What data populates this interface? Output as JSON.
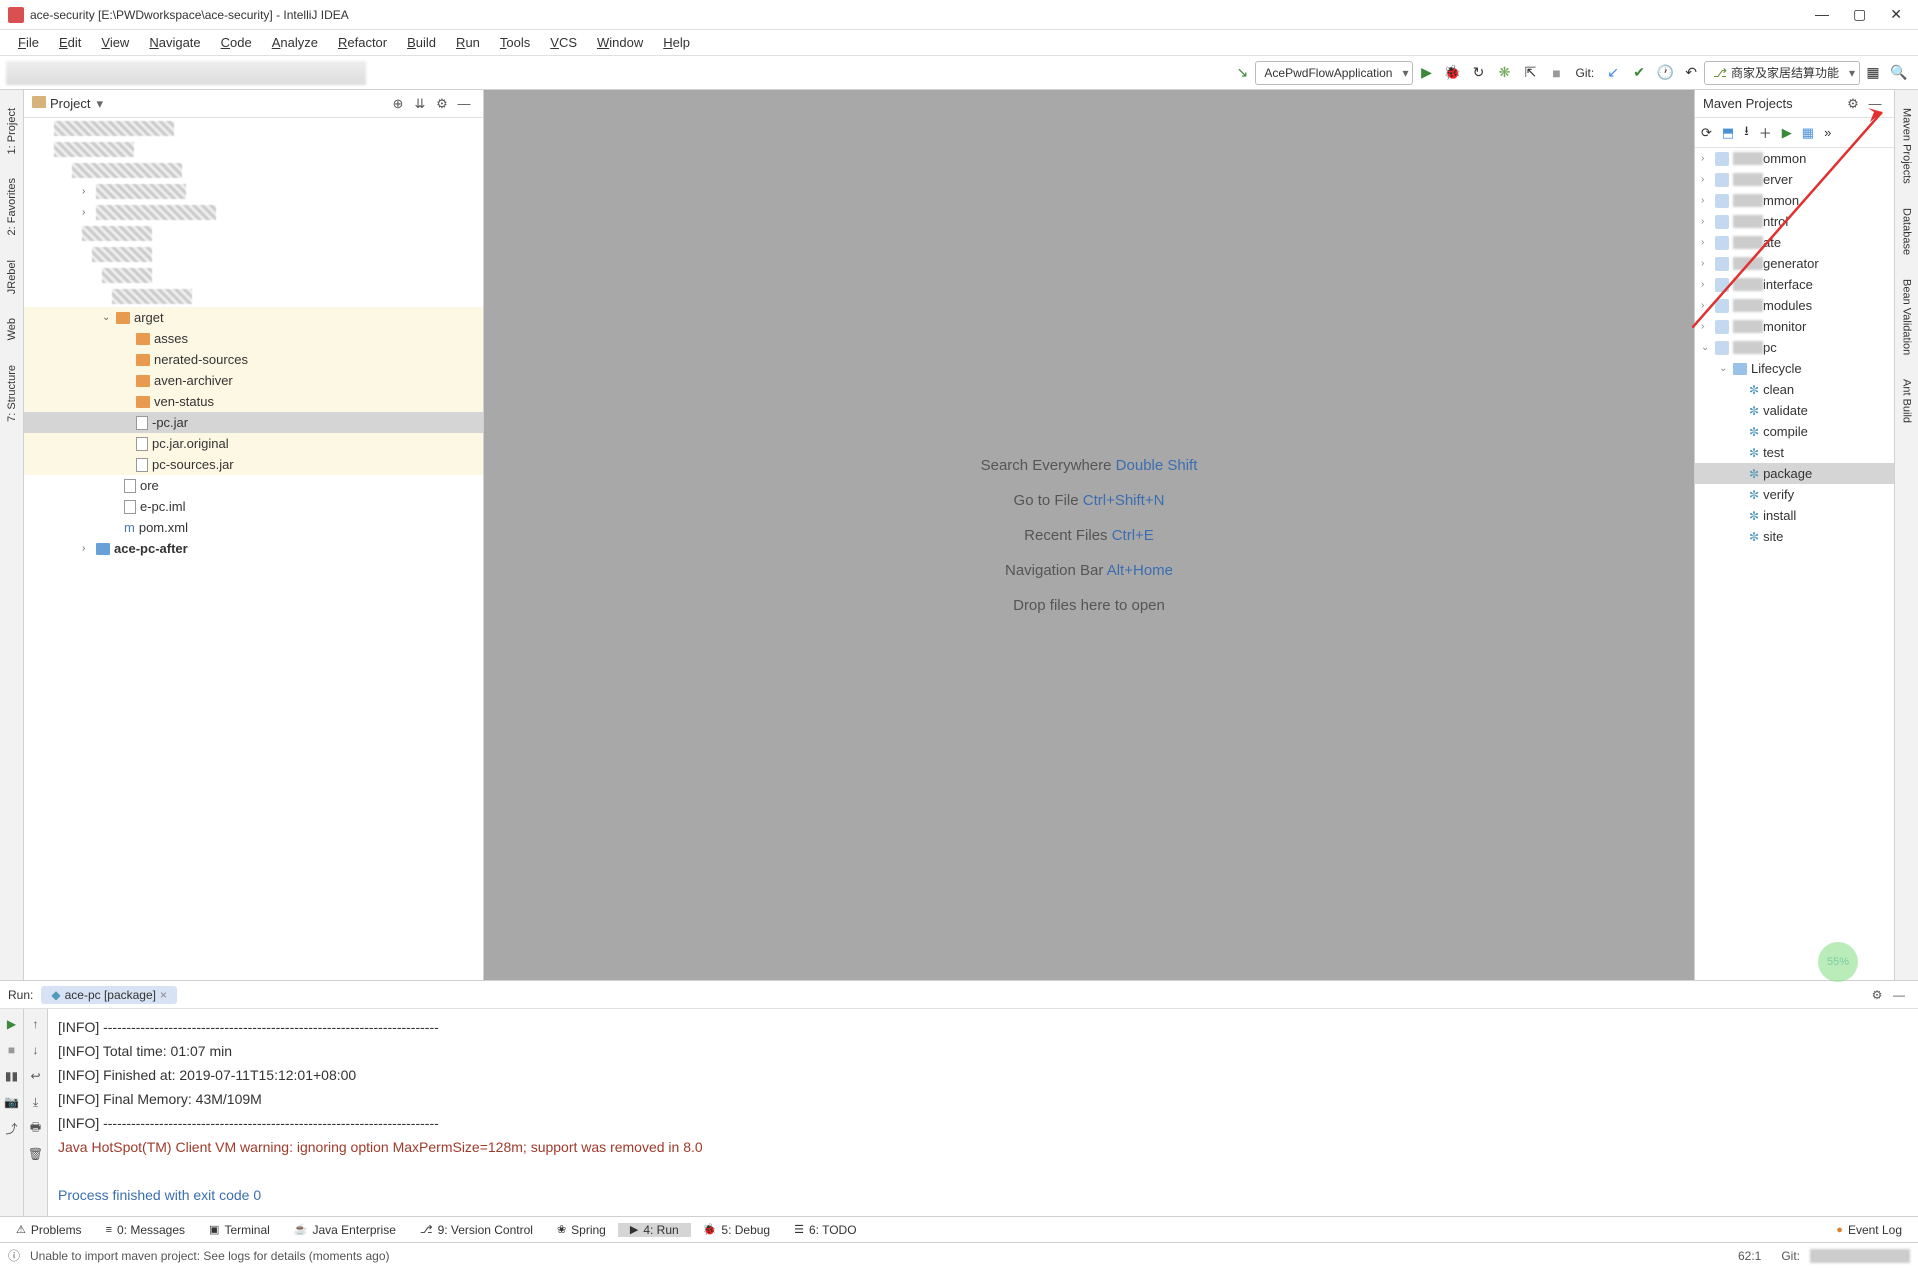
{
  "window": {
    "title": "ace-security [E:\\PWDworkspace\\ace-security] - IntelliJ IDEA"
  },
  "menu": [
    "File",
    "Edit",
    "View",
    "Navigate",
    "Code",
    "Analyze",
    "Refactor",
    "Build",
    "Run",
    "Tools",
    "VCS",
    "Window",
    "Help"
  ],
  "toolbar": {
    "run_config": "AcePwdFlowApplication",
    "git_label": "Git:",
    "branch_label": "商家及家居结算功能"
  },
  "panels": {
    "project": {
      "title": "Project"
    },
    "maven": {
      "title": "Maven Projects"
    }
  },
  "left_tabs": [
    "1: Project",
    "2: Favorites",
    "JRebel",
    "Web",
    "7: Structure"
  ],
  "right_tabs": [
    "Maven Projects",
    "Database",
    "Bean Validation",
    "Ant Build"
  ],
  "project_tree": {
    "target": "arget",
    "classes": "asses",
    "gensources": "nerated-sources",
    "archiver": "aven-archiver",
    "status": "ven-status",
    "pcjar": "-pc.jar",
    "pcjarorig": "pc.jar.original",
    "pcsources": "pc-sources.jar",
    "more": "ore",
    "iml": "e-pc.iml",
    "pom": "pom.xml",
    "after": "ace-pc-after"
  },
  "editor_hints": {
    "search": "Search Everywhere",
    "search_key": "Double Shift",
    "gotofile": "Go to File",
    "gotofile_key": "Ctrl+Shift+N",
    "recent": "Recent Files",
    "recent_key": "Ctrl+E",
    "navbar": "Navigation Bar",
    "navbar_key": "Alt+Home",
    "drop": "Drop files here to open"
  },
  "maven_tree": {
    "suffixes": [
      "ommon",
      "erver",
      "mmon",
      "ntrol",
      "ate",
      "generator",
      "interface",
      "modules",
      "monitor",
      "pc"
    ],
    "lifecycle_label": "Lifecycle",
    "lifecycle": [
      "clean",
      "validate",
      "compile",
      "test",
      "package",
      "verify",
      "install",
      "site"
    ]
  },
  "run": {
    "label": "Run:",
    "tab": "ace-pc [package]",
    "console": [
      {
        "cls": "",
        "text": "[INFO] ------------------------------------------------------------------------"
      },
      {
        "cls": "",
        "text": "[INFO] Total time: 01:07 min"
      },
      {
        "cls": "",
        "text": "[INFO] Finished at: 2019-07-11T15:12:01+08:00"
      },
      {
        "cls": "",
        "text": "[INFO] Final Memory: 43M/109M"
      },
      {
        "cls": "",
        "text": "[INFO] ------------------------------------------------------------------------"
      },
      {
        "cls": "warn",
        "text": "Java HotSpot(TM) Client VM warning: ignoring option MaxPermSize=128m; support was removed in 8.0"
      },
      {
        "cls": "",
        "text": ""
      },
      {
        "cls": "exit",
        "text": "Process finished with exit code 0"
      }
    ]
  },
  "bottom_tabs": [
    {
      "icon": "⚠",
      "label": "Problems"
    },
    {
      "icon": "≡",
      "label": "0: Messages"
    },
    {
      "icon": "▣",
      "label": "Terminal"
    },
    {
      "icon": "☕",
      "label": "Java Enterprise"
    },
    {
      "icon": "⎇",
      "label": "9: Version Control"
    },
    {
      "icon": "❀",
      "label": "Spring"
    },
    {
      "icon": "▶",
      "label": "4: Run",
      "active": true
    },
    {
      "icon": "🐞",
      "label": "5: Debug"
    },
    {
      "icon": "☰",
      "label": "6: TODO"
    }
  ],
  "event_log": "Event Log",
  "status": {
    "message": "Unable to import maven project: See logs for details (moments ago)",
    "pos": "62:1",
    "git": "Git:"
  },
  "badge": "55%"
}
